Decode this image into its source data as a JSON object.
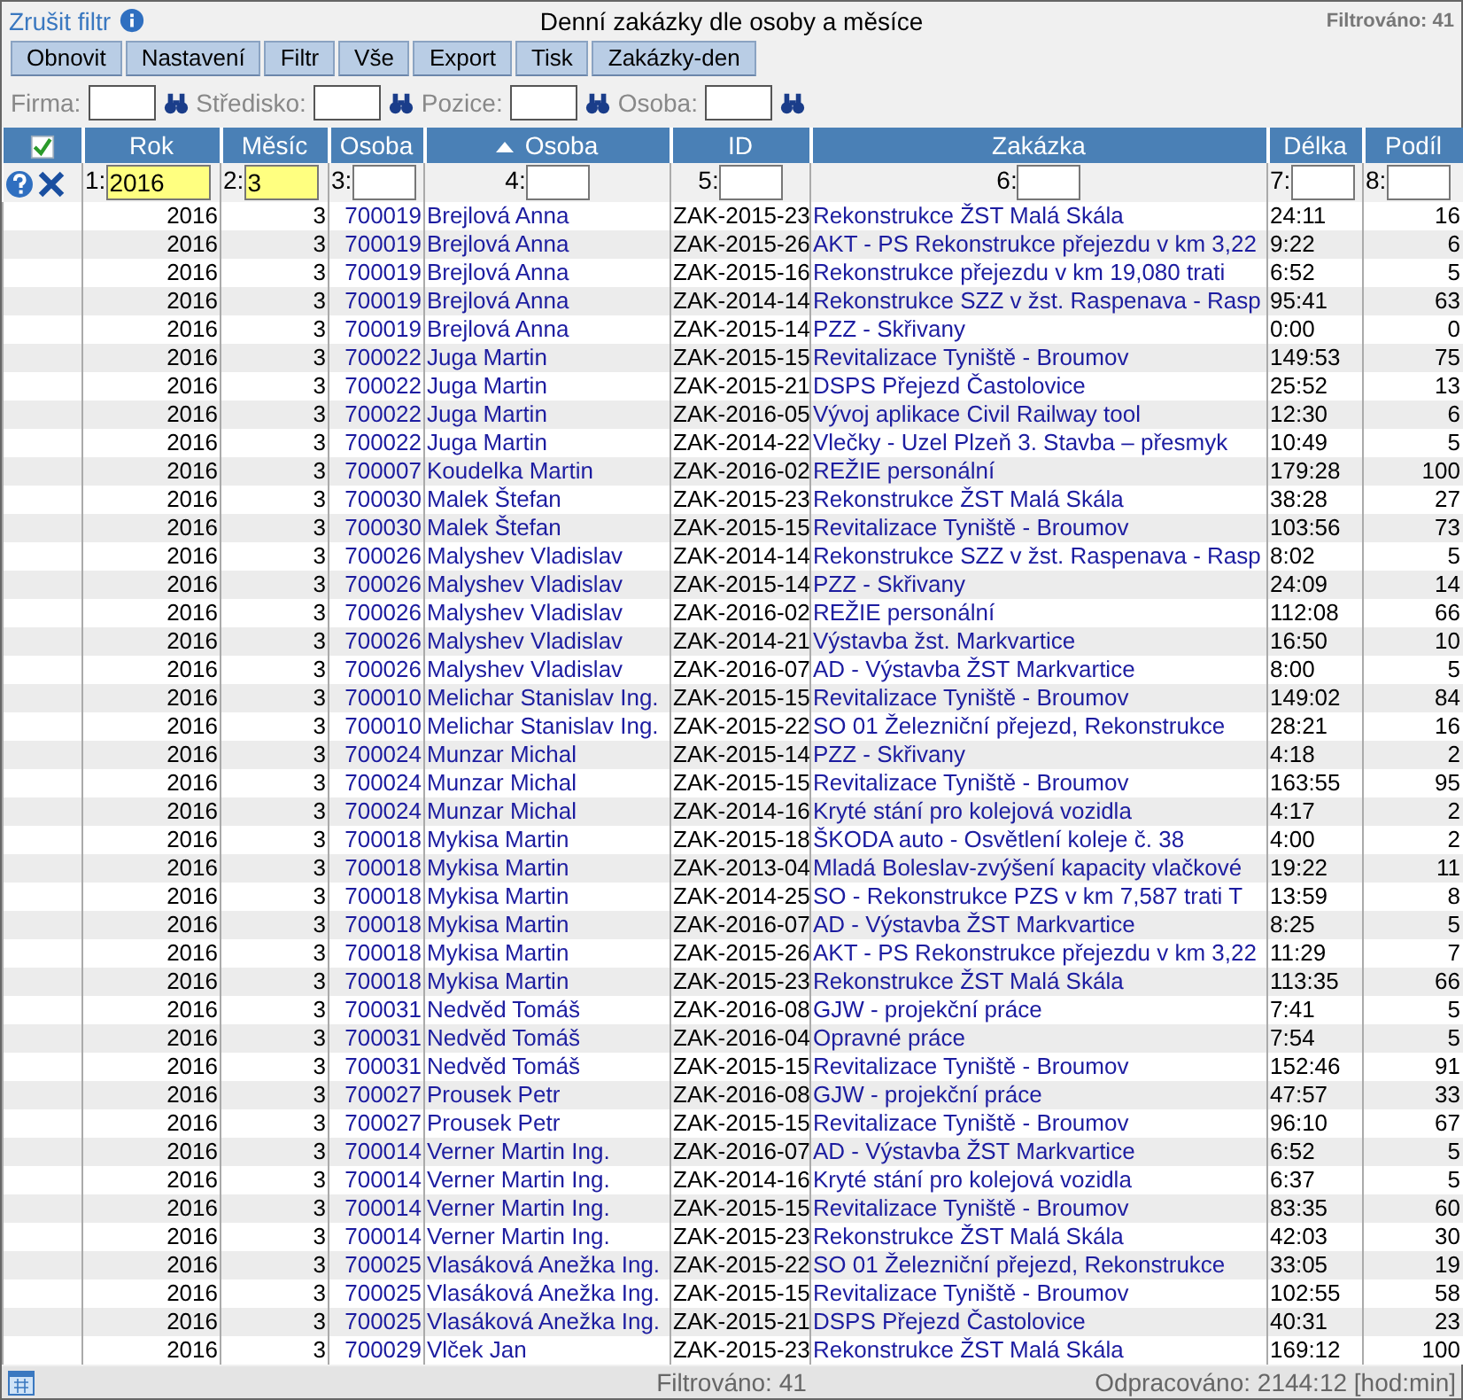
{
  "top_bar": {
    "clear_filter": "Zrušit filtr",
    "title": "Denní zakázky dle osoby a měsíce",
    "filtered": "Filtrováno: 41"
  },
  "toolbar": [
    "Obnovit",
    "Nastavení",
    "Filtr",
    "Vše",
    "Export",
    "Tisk",
    "Zakázky-den"
  ],
  "filters": [
    {
      "label": "Firma:"
    },
    {
      "label": "Středisko:"
    },
    {
      "label": "Pozice:"
    },
    {
      "label": "Osoba:"
    }
  ],
  "table": {
    "columns": [
      {
        "label": "Rok",
        "sorted": false
      },
      {
        "label": "Měsíc",
        "sorted": false
      },
      {
        "label": "Osoba",
        "sorted": false
      },
      {
        "label": "Osoba",
        "sorted": true
      },
      {
        "label": "ID",
        "sorted": false
      },
      {
        "label": "Zakázka",
        "sorted": false
      },
      {
        "label": "Délka",
        "sorted": false
      },
      {
        "label": "Podíl",
        "sorted": false
      }
    ],
    "column_filters": [
      {
        "label": "1:",
        "value": "2016"
      },
      {
        "label": "2:",
        "value": "3"
      },
      {
        "label": "3:"
      },
      {
        "label": "4:"
      },
      {
        "label": "5:"
      },
      {
        "label": "6:"
      },
      {
        "label": "7:"
      },
      {
        "label": "8:"
      }
    ],
    "rows": [
      [
        "2016",
        "3",
        "700019",
        "Brejlová Anna",
        "ZAK-2015-23",
        "Rekonstrukce ŽST Malá Skála",
        "24:11",
        "16"
      ],
      [
        "2016",
        "3",
        "700019",
        "Brejlová Anna",
        "ZAK-2015-26",
        "AKT - PS Rekonstrukce přejezdu v km 3,22",
        "9:22",
        "6"
      ],
      [
        "2016",
        "3",
        "700019",
        "Brejlová Anna",
        "ZAK-2015-16",
        "Rekonstrukce přejezdu v km 19,080 trati",
        "6:52",
        "5"
      ],
      [
        "2016",
        "3",
        "700019",
        "Brejlová Anna",
        "ZAK-2014-14",
        "Rekonstrukce SZZ v žst. Raspenava - Rasp",
        "95:41",
        "63"
      ],
      [
        "2016",
        "3",
        "700019",
        "Brejlová Anna",
        "ZAK-2015-14",
        "PZZ - Skřivany",
        "0:00",
        "0"
      ],
      [
        "2016",
        "3",
        "700022",
        "Juga Martin",
        "ZAK-2015-15",
        "Revitalizace Tyniště - Broumov",
        "149:53",
        "75"
      ],
      [
        "2016",
        "3",
        "700022",
        "Juga Martin",
        "ZAK-2015-21",
        "DSPS Přejezd Častolovice",
        "25:52",
        "13"
      ],
      [
        "2016",
        "3",
        "700022",
        "Juga Martin",
        "ZAK-2016-05",
        "Vývoj aplikace Civil Railway tool",
        "12:30",
        "6"
      ],
      [
        "2016",
        "3",
        "700022",
        "Juga Martin",
        "ZAK-2014-22",
        "Vlečky - Uzel Plzeň 3. Stavba – přesmyk",
        "10:49",
        "5"
      ],
      [
        "2016",
        "3",
        "700007",
        "Koudelka Martin",
        "ZAK-2016-02",
        "REŽIE personální",
        "179:28",
        "100"
      ],
      [
        "2016",
        "3",
        "700030",
        "Malek Štefan",
        "ZAK-2015-23",
        "Rekonstrukce ŽST Malá Skála",
        "38:28",
        "27"
      ],
      [
        "2016",
        "3",
        "700030",
        "Malek Štefan",
        "ZAK-2015-15",
        "Revitalizace Tyniště - Broumov",
        "103:56",
        "73"
      ],
      [
        "2016",
        "3",
        "700026",
        "Malyshev Vladislav",
        "ZAK-2014-14",
        "Rekonstrukce SZZ v žst. Raspenava - Rasp",
        "8:02",
        "5"
      ],
      [
        "2016",
        "3",
        "700026",
        "Malyshev Vladislav",
        "ZAK-2015-14",
        "PZZ - Skřivany",
        "24:09",
        "14"
      ],
      [
        "2016",
        "3",
        "700026",
        "Malyshev Vladislav",
        "ZAK-2016-02",
        "REŽIE personální",
        "112:08",
        "66"
      ],
      [
        "2016",
        "3",
        "700026",
        "Malyshev Vladislav",
        "ZAK-2014-21",
        "Výstavba žst. Markvartice",
        "16:50",
        "10"
      ],
      [
        "2016",
        "3",
        "700026",
        "Malyshev Vladislav",
        "ZAK-2016-07",
        "AD - Výstavba ŽST Markvartice",
        "8:00",
        "5"
      ],
      [
        "2016",
        "3",
        "700010",
        "Melichar Stanislav Ing.",
        "ZAK-2015-15",
        "Revitalizace Tyniště - Broumov",
        "149:02",
        "84"
      ],
      [
        "2016",
        "3",
        "700010",
        "Melichar Stanislav Ing.",
        "ZAK-2015-22",
        "SO 01 Železniční přejezd, Rekonstrukce",
        "28:21",
        "16"
      ],
      [
        "2016",
        "3",
        "700024",
        "Munzar Michal",
        "ZAK-2015-14",
        "PZZ - Skřivany",
        "4:18",
        "2"
      ],
      [
        "2016",
        "3",
        "700024",
        "Munzar Michal",
        "ZAK-2015-15",
        "Revitalizace Tyniště - Broumov",
        "163:55",
        "95"
      ],
      [
        "2016",
        "3",
        "700024",
        "Munzar Michal",
        "ZAK-2014-16",
        "Kryté stání pro kolejová vozidla",
        "4:17",
        "2"
      ],
      [
        "2016",
        "3",
        "700018",
        "Mykisa Martin",
        "ZAK-2015-18",
        "ŠKODA auto - Osvětlení koleje č. 38",
        "4:00",
        "2"
      ],
      [
        "2016",
        "3",
        "700018",
        "Mykisa Martin",
        "ZAK-2013-04",
        "Mladá Boleslav-zvýšení kapacity vlačkové",
        "19:22",
        "11"
      ],
      [
        "2016",
        "3",
        "700018",
        "Mykisa Martin",
        "ZAK-2014-25",
        "SO - Rekonstrukce PZS v km 7,587 trati T",
        "13:59",
        "8"
      ],
      [
        "2016",
        "3",
        "700018",
        "Mykisa Martin",
        "ZAK-2016-07",
        "AD - Výstavba ŽST Markvartice",
        "8:25",
        "5"
      ],
      [
        "2016",
        "3",
        "700018",
        "Mykisa Martin",
        "ZAK-2015-26",
        "AKT - PS Rekonstrukce přejezdu v km 3,22",
        "11:29",
        "7"
      ],
      [
        "2016",
        "3",
        "700018",
        "Mykisa Martin",
        "ZAK-2015-23",
        "Rekonstrukce ŽST Malá Skála",
        "113:35",
        "66"
      ],
      [
        "2016",
        "3",
        "700031",
        "Nedvěd Tomáš",
        "ZAK-2016-08",
        "GJW - projekční práce",
        "7:41",
        "5"
      ],
      [
        "2016",
        "3",
        "700031",
        "Nedvěd Tomáš",
        "ZAK-2016-04",
        "Opravné práce",
        "7:54",
        "5"
      ],
      [
        "2016",
        "3",
        "700031",
        "Nedvěd Tomáš",
        "ZAK-2015-15",
        "Revitalizace Tyniště - Broumov",
        "152:46",
        "91"
      ],
      [
        "2016",
        "3",
        "700027",
        "Prousek Petr",
        "ZAK-2016-08",
        "GJW - projekční práce",
        "47:57",
        "33"
      ],
      [
        "2016",
        "3",
        "700027",
        "Prousek Petr",
        "ZAK-2015-15",
        "Revitalizace Tyniště - Broumov",
        "96:10",
        "67"
      ],
      [
        "2016",
        "3",
        "700014",
        "Verner Martin Ing.",
        "ZAK-2016-07",
        "AD - Výstavba ŽST Markvartice",
        "6:52",
        "5"
      ],
      [
        "2016",
        "3",
        "700014",
        "Verner Martin Ing.",
        "ZAK-2014-16",
        "Kryté stání pro kolejová vozidla",
        "6:37",
        "5"
      ],
      [
        "2016",
        "3",
        "700014",
        "Verner Martin Ing.",
        "ZAK-2015-15",
        "Revitalizace Tyniště - Broumov",
        "83:35",
        "60"
      ],
      [
        "2016",
        "3",
        "700014",
        "Verner Martin Ing.",
        "ZAK-2015-23",
        "Rekonstrukce ŽST Malá Skála",
        "42:03",
        "30"
      ],
      [
        "2016",
        "3",
        "700025",
        "Vlasáková Anežka Ing.",
        "ZAK-2015-22",
        "SO 01 Železniční přejezd, Rekonstrukce",
        "33:05",
        "19"
      ],
      [
        "2016",
        "3",
        "700025",
        "Vlasáková Anežka Ing.",
        "ZAK-2015-15",
        "Revitalizace Tyniště - Broumov",
        "102:55",
        "58"
      ],
      [
        "2016",
        "3",
        "700025",
        "Vlasáková Anežka Ing.",
        "ZAK-2015-21",
        "DSPS Přejezd Častolovice",
        "40:31",
        "23"
      ],
      [
        "2016",
        "3",
        "700029",
        "Vlček Jan",
        "ZAK-2015-23",
        "Rekonstrukce ŽST Malá Skála",
        "169:12",
        "100"
      ]
    ]
  },
  "status_bar": {
    "filtered": "Filtrováno: 41",
    "worked": "Odpracováno: 2144:12 [hod:min]"
  }
}
